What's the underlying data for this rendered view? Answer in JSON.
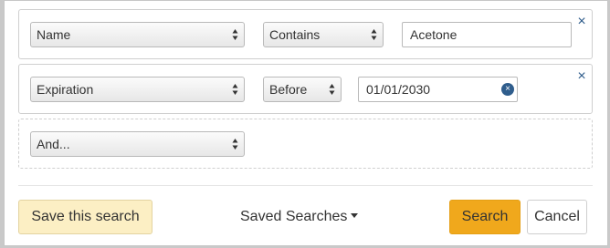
{
  "filters": [
    {
      "field": "Name",
      "operator": "Contains",
      "value": "Acetone"
    },
    {
      "field": "Expiration",
      "operator": "Before",
      "value": "01/01/2030"
    }
  ],
  "add_filter": {
    "label": "And..."
  },
  "icons": {
    "remove": "×",
    "clear": "×",
    "select_arrows": "updown-arrows-icon"
  },
  "footer": {
    "save_label": "Save this search",
    "saved_searches_label": "Saved Searches",
    "search_label": "Search",
    "cancel_label": "Cancel"
  },
  "colors": {
    "accent_link": "#2d5b8a",
    "search_button": "#f0a81c",
    "save_button": "#fcefc4"
  }
}
